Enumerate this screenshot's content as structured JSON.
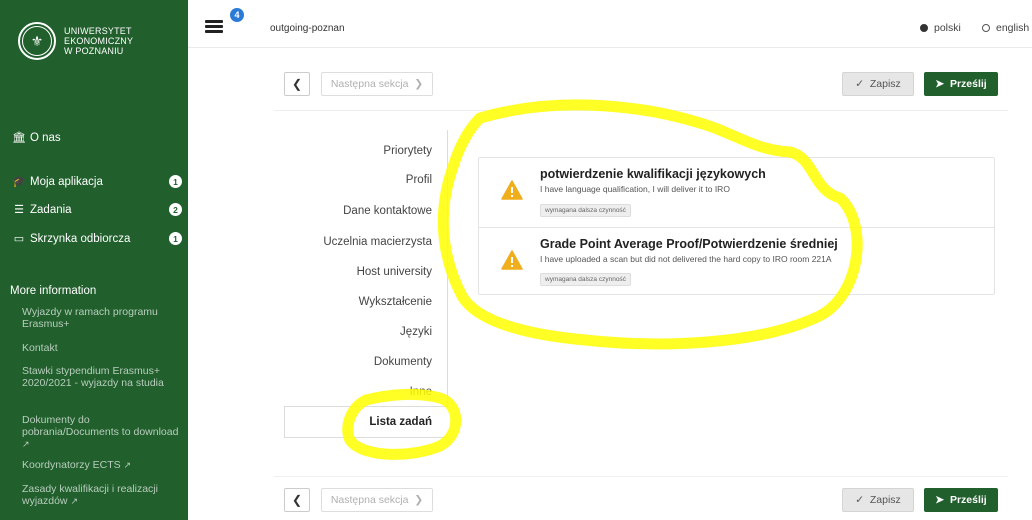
{
  "sidebar": {
    "logo_lines": [
      "UNIWERSYTET",
      "EKONOMICZNY",
      "W POZNANIU"
    ],
    "nav": [
      {
        "label": "O nas",
        "icon": "institution-icon"
      },
      {
        "label": "Moja aplikacja",
        "icon": "graduation-cap-icon",
        "badge": "1"
      },
      {
        "label": "Zadania",
        "icon": "list-icon",
        "badge": "2"
      },
      {
        "label": "Skrzynka odbiorcza",
        "icon": "inbox-icon",
        "badge": "1"
      }
    ],
    "more_title": "More information",
    "more_links": [
      "Wyjazdy w ramach programu Erasmus+",
      "Kontakt",
      "Stawki stypendium Erasmus+ 2020/2021 - wyjazdy na studia",
      "Dokumenty do pobrania/Documents to download",
      "Koordynatorzy ECTS",
      "Zasady kwalifikacji i realizacji wyjazdów"
    ]
  },
  "topbar": {
    "notif_count": "4",
    "breadcrumb": "outgoing-poznan",
    "lang_pl": "polski",
    "lang_en": "english",
    "selected_lang": "polski"
  },
  "toolbar": {
    "next_label": "Następna sekcja",
    "save_label": "Zapisz",
    "send_label": "Prześlij"
  },
  "sections": [
    "Priorytety",
    "Profil",
    "Dane kontaktowe",
    "Uczelnia macierzysta",
    "Host university",
    "Wykształcenie",
    "Języki",
    "Dokumenty",
    "Inne",
    "Lista zadań"
  ],
  "active_section": "Lista zadań",
  "tasks": [
    {
      "title": "potwierdzenie kwalifikacji językowych",
      "desc": "I have language qualification, I will deliver it to IRO",
      "tag": "wymagana dalsza czynność"
    },
    {
      "title": "Grade Point Average Proof/Potwierdzenie średniej",
      "desc": "I have uploaded a scan but did not delivered the hard copy to IRO room 221A",
      "tag": "wymagana dalsza czynność"
    }
  ],
  "colors": {
    "brand_green": "#215f2d",
    "warning": "#f0ad1c",
    "badge_blue": "#2a7bd5",
    "highlighter": "#ffff00"
  }
}
